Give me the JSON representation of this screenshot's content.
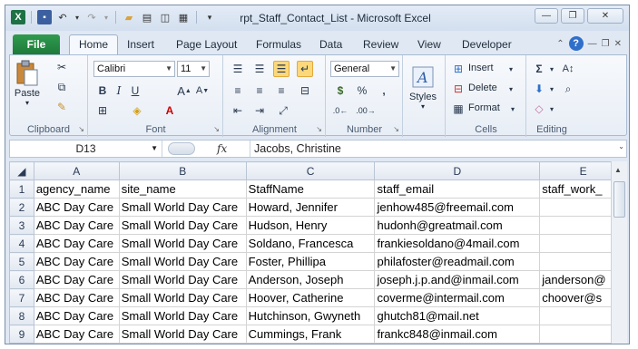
{
  "window": {
    "title": "rpt_Staff_Contact_List  -  Microsoft Excel"
  },
  "tabs": {
    "file": "File",
    "items": [
      "Home",
      "Insert",
      "Page Layout",
      "Formulas",
      "Data",
      "Review",
      "View",
      "Developer"
    ]
  },
  "ribbon": {
    "clipboard": {
      "label": "Clipboard",
      "paste": "Paste"
    },
    "font": {
      "label": "Font",
      "family": "Calibri",
      "size": "11",
      "bold": "B",
      "italic": "I",
      "underline": "U"
    },
    "alignment": {
      "label": "Alignment"
    },
    "number": {
      "label": "Number",
      "format": "General",
      "currency": "$",
      "percent": "%",
      "comma": ","
    },
    "styles": {
      "label": "Styles",
      "button": "Styles"
    },
    "cells": {
      "label": "Cells",
      "insert": "Insert",
      "delete": "Delete",
      "format": "Format"
    },
    "editing": {
      "label": "Editing"
    }
  },
  "formula_bar": {
    "name_box": "D13",
    "fx": "fx",
    "value": "Jacobs, Christine"
  },
  "sheet": {
    "columns": [
      "A",
      "B",
      "C",
      "D",
      "E"
    ],
    "rows": [
      {
        "num": "1",
        "cells": [
          "agency_name",
          "site_name",
          "StaffName",
          "staff_email",
          "staff_work_"
        ]
      },
      {
        "num": "2",
        "cells": [
          "ABC Day Care",
          "Small World Day Care",
          "Howard, Jennifer",
          "jenhow485@freemail.com",
          ""
        ]
      },
      {
        "num": "3",
        "cells": [
          "ABC Day Care",
          "Small World Day Care",
          "Hudson, Henry",
          "hudonh@greatmail.com",
          ""
        ]
      },
      {
        "num": "4",
        "cells": [
          "ABC Day Care",
          "Small World Day Care",
          "Soldano, Francesca",
          "frankiesoldano@4mail.com",
          ""
        ]
      },
      {
        "num": "5",
        "cells": [
          "ABC Day Care",
          "Small World Day Care",
          "Foster, Phillipa",
          "philafoster@readmail.com",
          ""
        ]
      },
      {
        "num": "6",
        "cells": [
          "ABC Day Care",
          "Small World Day Care",
          "Anderson, Joseph",
          "joseph.j.p.and@inmail.com",
          "janderson@"
        ]
      },
      {
        "num": "7",
        "cells": [
          "ABC Day Care",
          "Small World Day Care",
          "Hoover, Catherine",
          "coverme@intermail.com",
          "choover@s"
        ]
      },
      {
        "num": "8",
        "cells": [
          "ABC Day Care",
          "Small World Day Care",
          "Hutchinson, Gwyneth",
          "ghutch81@mail.net",
          ""
        ]
      },
      {
        "num": "9",
        "cells": [
          "ABC Day Care",
          "Small World Day Care",
          "Cummings, Frank",
          "frankc848@inmail.com",
          ""
        ]
      }
    ]
  },
  "colors": {
    "file_tab": "#1e7a3a",
    "ribbon_bg": "#e8eef6",
    "selected_align": "#fbd87a",
    "header_bg": "#e2e8f1"
  }
}
